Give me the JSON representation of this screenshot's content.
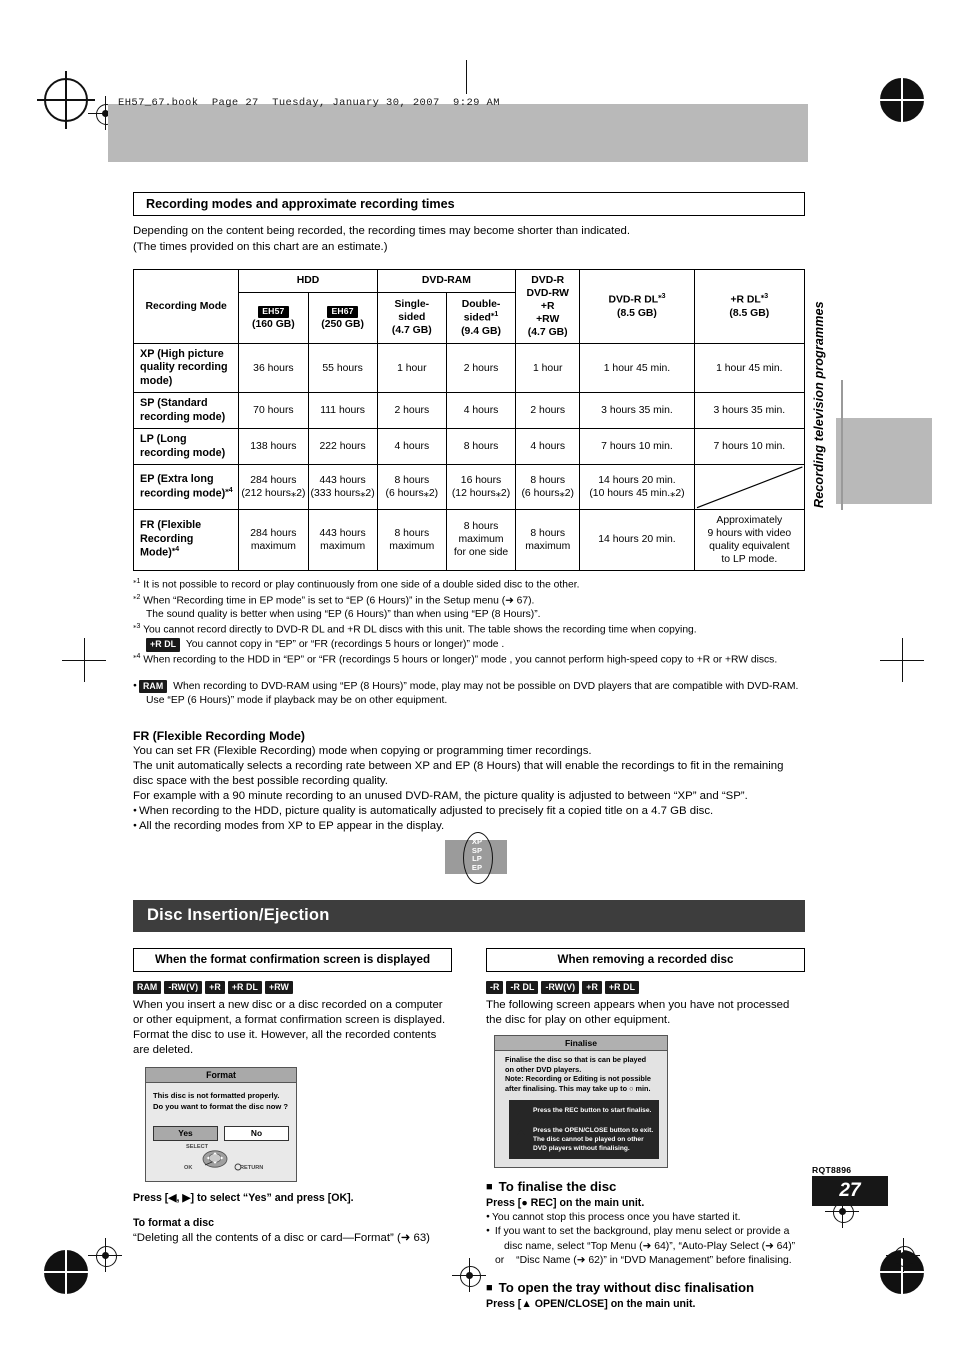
{
  "header": {
    "book_line": "EH57_67.book  Page 27  Tuesday, January 30, 2007  9:29 AM",
    "side_title": "Recording television programmes",
    "rqt": "RQT8896",
    "page_number": "27"
  },
  "section1": {
    "title": "Recording modes and approximate recording times",
    "intro_line1": "Depending on the content being recorded, the recording times may become shorter than indicated.",
    "intro_line2": "(The times provided on this chart are an estimate.)"
  },
  "table": {
    "row_header": "Recording Mode",
    "group_hdd": "HDD",
    "group_dvdram": "DVD-RAM",
    "cols": [
      {
        "badge": "EH57",
        "line2": "(160 GB)"
      },
      {
        "badge": "EH67",
        "line2": "(250 GB)"
      },
      {
        "line1": "Single-",
        "line2": "sided",
        "line3": "(4.7 GB)"
      },
      {
        "line1": "Double-",
        "line2": "sided",
        "mark": "⁎1",
        "line3": "(9.4 GB)"
      },
      {
        "line1": "DVD-R",
        "line2": "DVD-RW",
        "line3": "+R",
        "line4": "+RW",
        "line5": "(4.7 GB)"
      },
      {
        "line1": "DVD-R DL",
        "mark": "⁎3",
        "line2": "(8.5 GB)"
      },
      {
        "line1": "+R DL",
        "mark": "⁎3",
        "line2": "(8.5 GB)"
      }
    ],
    "rows": [
      {
        "mode": "XP (High picture quality recording mode)",
        "mode_lines": [
          "XP (High picture",
          "quality recording",
          "mode)"
        ],
        "values": [
          "36 hours",
          "55 hours",
          "1 hour",
          "2 hours",
          "1 hour",
          "1 hour 45 min.",
          "1 hour 45 min."
        ]
      },
      {
        "mode": "SP (Standard recording mode)",
        "mode_lines": [
          "SP (Standard",
          "recording mode)"
        ],
        "values": [
          "70 hours",
          "111 hours",
          "2 hours",
          "4 hours",
          "2 hours",
          "3 hours 35 min.",
          "3 hours 35 min."
        ]
      },
      {
        "mode": "LP (Long recording mode)",
        "mode_lines": [
          "LP (Long",
          "recording mode)"
        ],
        "values": [
          "138 hours",
          "222 hours",
          "4 hours",
          "8 hours",
          "4 hours",
          "7 hours 10 min.",
          "7 hours 10 min."
        ]
      },
      {
        "mode": "EP (Extra long recording mode)",
        "mode_lines": [
          "EP (Extra long",
          "recording mode)"
        ],
        "mode_mark": "⁎4",
        "values": [
          "284 hours",
          "443 hours",
          "8 hours",
          "16 hours",
          "8 hours",
          "14 hours 20 min.",
          ""
        ],
        "sub": [
          "(212 hours⁎2)",
          "(333 hours⁎2)",
          "(6 hours⁎2)",
          "(12 hours⁎2)",
          "(6 hours⁎2)",
          "(10 hours 45 min.⁎2)",
          ""
        ],
        "last_is_diagonal": true
      },
      {
        "mode": "FR (Flexible Recording Mode)",
        "mode_lines": [
          "FR (Flexible",
          "Recording",
          "Mode)"
        ],
        "mode_mark": "⁎4",
        "values": [
          "284 hours maximum",
          "443 hours maximum",
          "8 hours maximum",
          "8 hours maximum for one side",
          "8 hours maximum",
          "14 hours 20 min.",
          "Approximately 9 hours with video quality equivalent to LP mode."
        ],
        "value_lines": [
          [
            "284 hours",
            "maximum"
          ],
          [
            "443 hours",
            "maximum"
          ],
          [
            "8 hours",
            "maximum"
          ],
          [
            "8 hours",
            "maximum",
            "for one side"
          ],
          [
            "8 hours",
            "maximum"
          ],
          [
            "14 hours 20 min."
          ],
          [
            "Approximately",
            "9 hours with video",
            "quality equivalent",
            "to LP mode."
          ]
        ]
      }
    ]
  },
  "footnotes": [
    {
      "mark": "⁎1",
      "text": "It is not possible to record or play continuously from one side of a double sided disc to the other."
    },
    {
      "mark": "⁎2",
      "text": "When “Recording time in EP mode” is set to “EP (6 Hours)” in the Setup menu (➜ 67).",
      "cont": "The sound quality is better when using “EP (6 Hours)” than when using “EP (8 Hours)”."
    },
    {
      "mark": "⁎3",
      "text": "You cannot record directly to DVD-R DL and +R DL discs with this unit. The table shows the recording time when copying.",
      "tag": "+R DL",
      "cont": "You cannot copy in “EP” or “FR (recordings 5 hours or longer)” mode ."
    },
    {
      "mark": "⁎4",
      "text": "When recording to the HDD in “EP” or “FR (recordings 5 hours or longer)” mode , you cannot perform high-speed copy to +R or +RW discs."
    }
  ],
  "ram_note": {
    "tag": "RAM",
    "line1": "When recording to DVD-RAM using “EP (8 Hours)” mode, play may not be possible on DVD players that are compatible with DVD-RAM.",
    "line2": "Use “EP (6 Hours)” mode if playback may be on other equipment."
  },
  "fr_section": {
    "heading": "FR (Flexible Recording Mode)",
    "line1": "You can set FR (Flexible Recording) mode when copying or programming timer recordings.",
    "line2": "The unit automatically selects a recording rate between XP and EP (8 Hours) that will enable the recordings to fit in the remaining disc space with the best possible recording quality.",
    "line3": "For example with a 90 minute recording to an unused DVD-RAM, the picture quality is adjusted to between “XP” and “SP”.",
    "bullet1": "When recording to the HDD, picture quality is automatically adjusted to precisely fit a copied title on a 4.7 GB disc.",
    "bullet2": "All the recording modes from XP to EP appear in the display.",
    "display_modes": [
      "XP",
      "SP",
      "LP",
      "EP"
    ]
  },
  "section2": {
    "title": "Disc Insertion/Ejection"
  },
  "left_col": {
    "title": "When the format confirmation screen is displayed",
    "tags": [
      "RAM",
      "-RW(V)",
      "+R",
      "+R DL",
      "+RW"
    ],
    "body": "When you insert a new disc or a disc recorded on a computer or other equipment, a format confirmation screen is displayed. Format the disc to use it. However, all the recorded contents are deleted.",
    "dialog": {
      "title": "Format",
      "line1": "This disc is not formatted properly.",
      "line2": "Do you want to format the disc now ?",
      "yes": "Yes",
      "no": "No",
      "select_label": "SELECT",
      "ok_label": "OK",
      "return_label": "RETURN"
    },
    "instruction": "Press [◀, ▶] to select “Yes” and press [OK].",
    "subheading": "To format a disc",
    "subtext": "“Deleting all the contents of a disc or card—Format” (➜ 63)"
  },
  "right_col": {
    "title": "When removing a recorded disc",
    "tags": [
      "-R",
      "-R DL",
      "-RW(V)",
      "+R",
      "+R DL"
    ],
    "body": "The following screen appears when you have not processed the disc for play on other equipment.",
    "dialog": {
      "title": "Finalise",
      "line1": "Finalise the disc so that is can be played",
      "line2": "on other DVD players.",
      "line3": "Note: Recording or Editing is not possible",
      "line4": "after finalising. This may take up to ○ min.",
      "rec_text": "Press the REC button to start finalise.",
      "eject_line1": "Press the OPEN/CLOSE button to exit.",
      "eject_line2": "The disc cannot be played on other",
      "eject_line3": "DVD players without finalising."
    },
    "heading1": "To finalise the disc",
    "press1": "Press [● REC] on the main unit.",
    "bullet1": "You cannot stop this process once you have started it.",
    "bullet2_a": "If you want to set the background, play menu select or provide a",
    "bullet2_b": "disc name, select “Top Menu (➜ 64)”, “Auto-Play Select (➜ 64)” or",
    "bullet2_c": "“Disc Name (➜ 62)” in “DVD Management” before finalising.",
    "heading2": "To open the tray without disc finalisation",
    "press2": "Press [▲ OPEN/CLOSE] on the main unit."
  }
}
